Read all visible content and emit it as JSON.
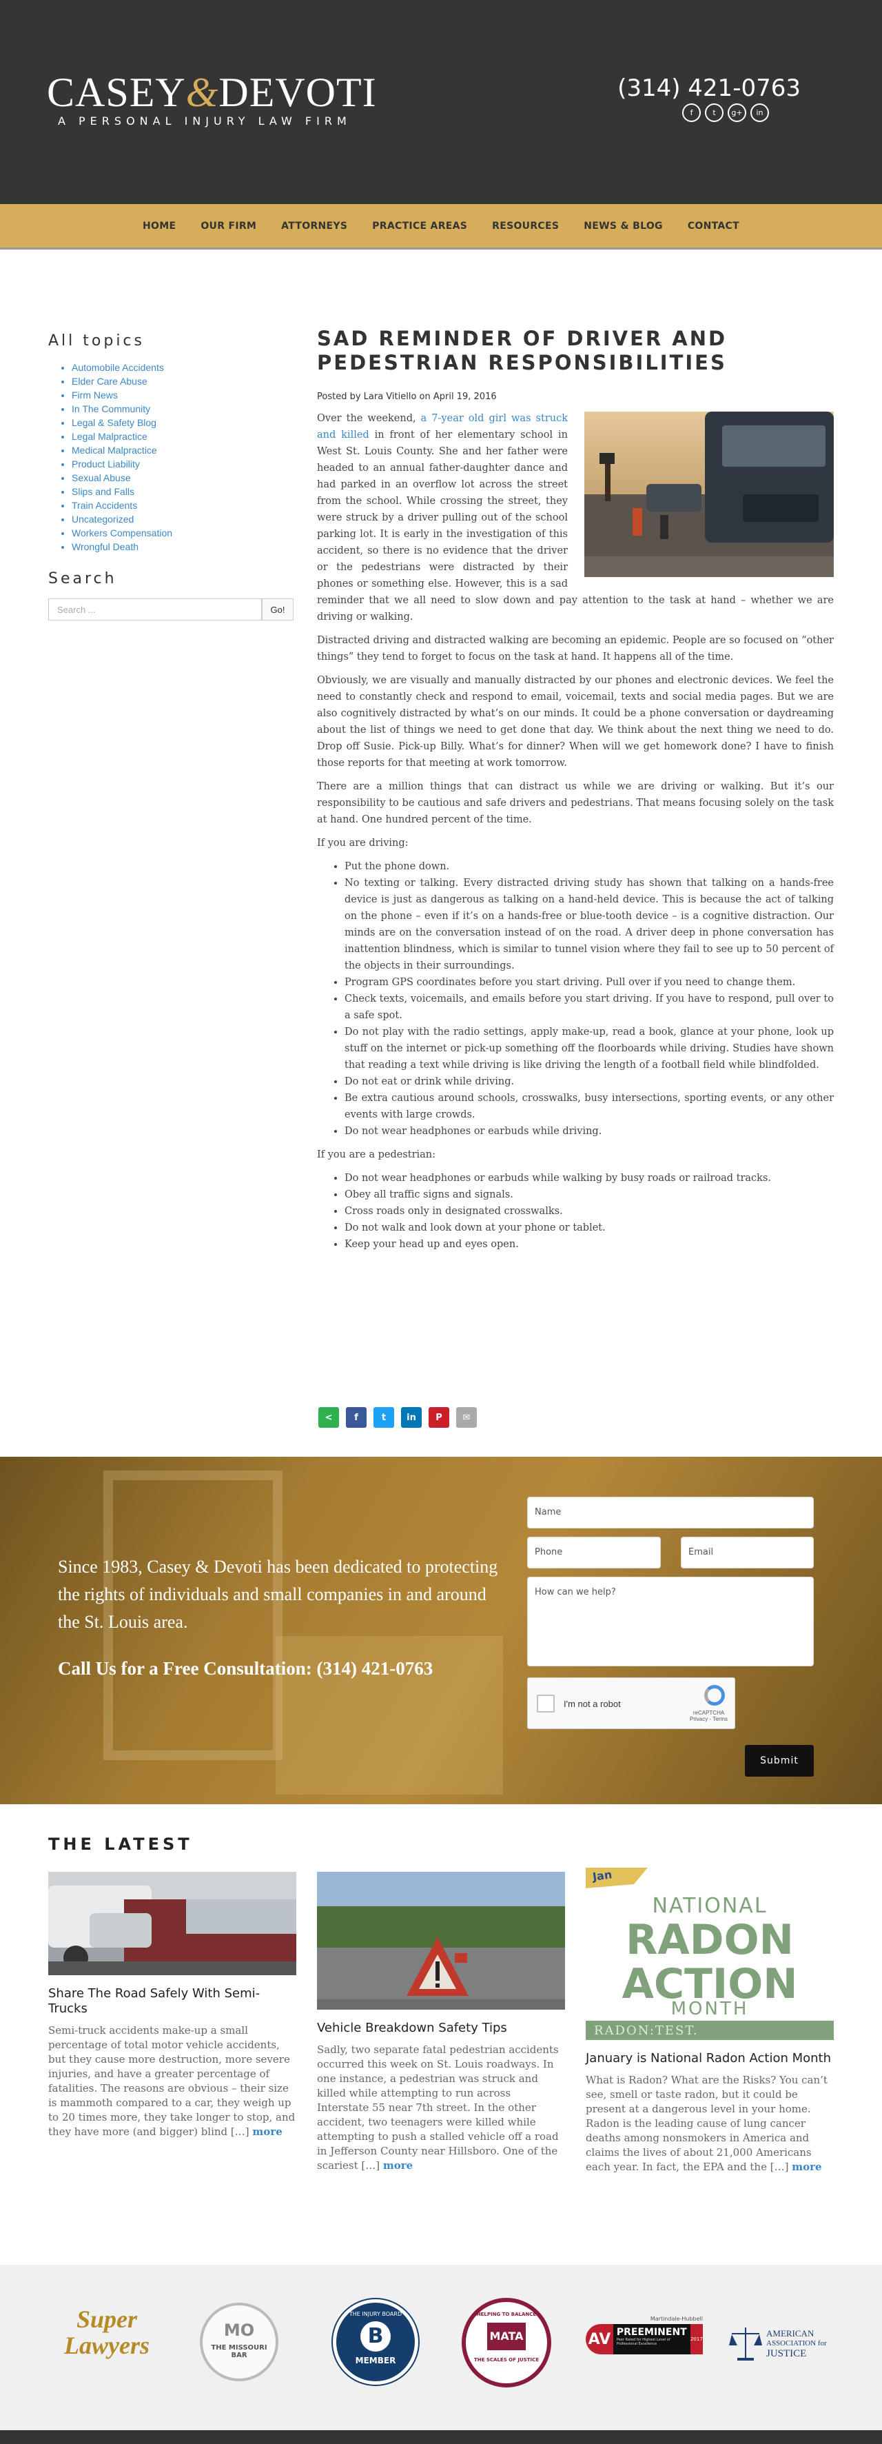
{
  "header": {
    "logo_name_1": "CASEY",
    "logo_amp": "&",
    "logo_name_2": "DEVOTI",
    "tagline": "A PERSONAL INJURY LAW FIRM",
    "phone": "(314) 421-0763",
    "social": [
      "f",
      "t",
      "g+",
      "in"
    ]
  },
  "nav": [
    "HOME",
    "OUR FIRM",
    "ATTORNEYS",
    "PRACTICE AREAS",
    "RESOURCES",
    "NEWS & BLOG",
    "CONTACT"
  ],
  "sidebar": {
    "topics_heading": "All topics",
    "topics": [
      "Automobile Accidents",
      "Elder Care Abuse",
      "Firm News",
      "In The Community",
      "Legal & Safety Blog",
      "Legal Malpractice",
      "Medical Malpractice",
      "Product Liability",
      "Sexual Abuse",
      "Slips and Falls",
      "Train Accidents",
      "Uncategorized",
      "Workers Compensation",
      "Wrongful Death"
    ],
    "search_heading": "Search",
    "search_placeholder": "Search ...",
    "search_button": "Go!"
  },
  "article": {
    "title": "SAD REMINDER OF DRIVER AND PEDESTRIAN RESPONSIBILITIES",
    "meta": "Posted by Lara Vitiello on April 19, 2016",
    "p1_before": "Over the weekend, ",
    "p1_link": "a 7-year old girl was struck and killed",
    "p1_after": " in front of her elementary school in West St. Louis County. She and her father were headed to an annual father-daughter dance and had parked in an overflow lot across the street from the school.  While crossing the street, they were struck by a driver pulling out of the school parking lot.  It is early in the investigation of this accident, so there is no evidence that the driver or the pedestrians were distracted by their phones or something else.  However, this is a sad reminder that we all need to slow down and pay attention to the task at hand – whether we are driving or walking.",
    "p2": "Distracted driving and distracted walking are becoming an epidemic. People are so focused on “other things” they tend to forget to focus on the task at hand.  It happens all of the time.",
    "p3": "Obviously, we are visually and manually distracted by our phones and electronic devices. We feel the need to constantly check and respond to email, voicemail, texts and social media pages.  But we are also cognitively distracted by what’s on our minds.   It could be a phone conversation or daydreaming about the list of things we need to get done that day.  We think about the next thing we need to do.  Drop off Susie.  Pick-up Billy.  What’s for dinner?  When will we get homework done?  I have to finish those reports for that meeting at work tomorrow.",
    "p4": "There are a million things that can distract us while we are driving or walking.  But it’s our responsibility to be cautious and safe drivers and pedestrians.  That means focusing solely on the task at hand.  One hundred percent of the time.",
    "driving_intro": "If you are driving:",
    "driving": [
      "Put the phone down.",
      "No texting or talking. Every distracted driving study has shown that talking on a hands-free device is just as dangerous as talking on a hand-held device.  This is because the act of talking on the phone – even if it’s on a hands-free or blue-tooth device – is a cognitive distraction.  Our minds are on the conversation instead of on the road.  A driver deep in phone conversation has inattention blindness, which is similar to tunnel vision where they fail to see up to 50 percent of the objects in their surroundings.",
      "Program GPS coordinates before you start driving. Pull over if you need to change them.",
      "Check texts, voicemails, and emails before you start driving.  If you have to respond, pull over to a safe spot.",
      "Do not play with the radio settings, apply make-up, read a book, glance at your phone, look up stuff on the internet or pick-up something off the floorboards while driving.  Studies have shown that reading a text while driving is like driving the length of a football field while blindfolded.",
      "Do not eat or drink while driving.",
      "Be extra cautious around schools, crosswalks, busy intersections, sporting events, or any other events with large crowds.",
      "Do not wear headphones or earbuds while driving."
    ],
    "pedestrian_intro": "If you are a pedestrian:",
    "pedestrian": [
      "Do not wear headphones or earbuds while walking by busy roads or railroad tracks.",
      "Obey all traffic signs and signals.",
      "Cross roads only in designated crosswalks.",
      "Do not walk and look down at your phone or tablet.",
      "Keep your head up and eyes open."
    ]
  },
  "share": [
    {
      "icon": "share-icon",
      "glyph": "<",
      "color": "#2fb150"
    },
    {
      "icon": "facebook-icon",
      "glyph": "f",
      "color": "#3b5998"
    },
    {
      "icon": "twitter-icon",
      "glyph": "t",
      "color": "#1da1f2"
    },
    {
      "icon": "linkedin-icon",
      "glyph": "in",
      "color": "#0077b5"
    },
    {
      "icon": "pinterest-icon",
      "glyph": "P",
      "color": "#cb2027"
    },
    {
      "icon": "email-icon",
      "glyph": "✉",
      "color": "#aaaaaa"
    }
  ],
  "cta": {
    "text": "Since 1983, Casey & Devoti has been dedicated to protecting the rights of individuals and small companies in and around the St. Louis area.",
    "call": "Call Us for a Free Consultation: (314) 421-0763",
    "name_placeholder": "Name",
    "phone_placeholder": "Phone",
    "email_placeholder": "Email",
    "message_placeholder": "How can we help?",
    "captcha_label": "I'm not a robot",
    "captcha_brand": "reCAPTCHA",
    "captcha_links": "Privacy - Terms",
    "submit": "Submit"
  },
  "latest": {
    "heading": "THE LATEST",
    "posts": [
      {
        "title": "Share The Road Safely With Semi-Trucks",
        "excerpt": "Semi-truck accidents make-up a small percentage of total motor vehicle accidents, but they cause more destruction, more severe injuries, and have a greater percentage of fatalities. The reasons are obvious – their size is mammoth compared to a car, they weigh up to 20 times more, they take longer to stop, and they have more (and bigger) blind […]",
        "more": "more"
      },
      {
        "title": "Vehicle Breakdown Safety Tips",
        "excerpt": "Sadly, two separate fatal pedestrian accidents occurred this week on St. Louis roadways. In one instance, a pedestrian was struck and killed while attempting to run across Interstate 55 near 7th street. In the other accident, two teenagers were killed while attempting to push a stalled vehicle off a road in Jefferson County near Hillsboro. One of the scariest […]",
        "more": "more"
      },
      {
        "title": "January is National Radon Action Month",
        "excerpt": "What is Radon? What are the Risks? You can’t see, smell or taste radon, but it could be present at a dangerous level in your home. Radon is the leading cause of lung cancer deaths among nonsmokers in America and claims the lives of about 21,000 Americans each year. In fact, the EPA and the […]",
        "more": "more",
        "graphic": {
          "banner": "Jan",
          "line1": "NATIONAL",
          "line2": "RADON",
          "line3": "ACTION",
          "line4": "MONTH",
          "bar": "RADON:TEST."
        }
      }
    ]
  },
  "badges": {
    "super_lawyers": "Super Lawyers",
    "missouri_bar_top": "MO",
    "missouri_bar": "THE MISSOURI BAR",
    "injury_board_top": "THE INJURY BOARD",
    "injury_board_member": "MEMBER",
    "mata_top": "HELPING TO BALANCE",
    "mata": "MATA",
    "mata_bottom": "THE SCALES OF JUSTICE",
    "martindale": "Martindale-Hubbell",
    "av": "AV",
    "preeminent": "PREEMINENT",
    "av_sub": "Peer Rated for Highest Level of Professional Excellence",
    "av_year": "2017",
    "aaj_1": "AMERICAN",
    "aaj_2": "ASSOCIATION for",
    "aaj_3": "JUSTICE"
  },
  "colors": {
    "header_bg": "#353535",
    "gold": "#d5ad5b",
    "link": "#3a87c7"
  }
}
